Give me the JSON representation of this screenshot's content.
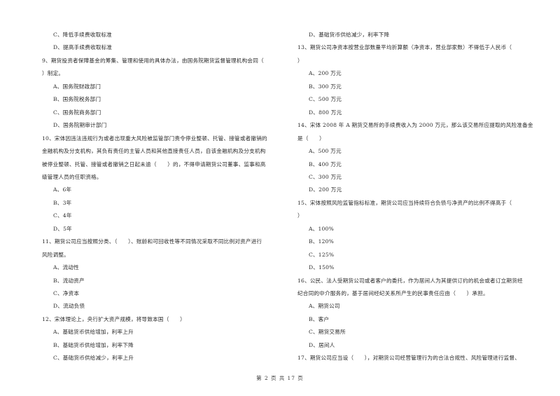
{
  "left_column": [
    {
      "kind": "option",
      "text": "C、降低手续费收取标准"
    },
    {
      "kind": "option",
      "text": "D、提高手续费收取标准"
    },
    {
      "kind": "question",
      "text": "9、期货投资者保障基金的筹集、管理和使用的具体办法，由国务院期货监督管理机构会同（"
    },
    {
      "kind": "cont",
      "text": "）制定。"
    },
    {
      "kind": "option",
      "text": "A、国务院财政部门"
    },
    {
      "kind": "option",
      "text": "B、国务院税务部门"
    },
    {
      "kind": "option",
      "text": "C、国务院商务部门"
    },
    {
      "kind": "option",
      "text": "D、国务院期审计部门"
    },
    {
      "kind": "question",
      "text": "10、宋体因违法违规行为或者出现重大风险被监管部门责令停业整顿、托管、接管或者撤销的"
    },
    {
      "kind": "cont",
      "text": "金融机构及分支机构，其负有责任的主管人员和其他直接责任人员，自该金融机构及分支机构"
    },
    {
      "kind": "cont",
      "text": "被停业整顿、托管、接管或者撤销之日起未逾（　　）的，不得申请期货公司董事、监事和高"
    },
    {
      "kind": "cont",
      "text": "级管理人员的任职资格。"
    },
    {
      "kind": "option",
      "text": "A、6年"
    },
    {
      "kind": "option",
      "text": "B、3年"
    },
    {
      "kind": "option",
      "text": "C、4年"
    },
    {
      "kind": "option",
      "text": "D、5年"
    },
    {
      "kind": "question",
      "text": "11、期货公司应当按照分类、（　　）、账龄和可回收性等不同情况采取不同比例对资产进行"
    },
    {
      "kind": "cont",
      "text": "风险调整。"
    },
    {
      "kind": "option",
      "text": "A、流动性"
    },
    {
      "kind": "option",
      "text": "B、流动资产"
    },
    {
      "kind": "option",
      "text": "C、净资本"
    },
    {
      "kind": "option",
      "text": "D、流动负债"
    },
    {
      "kind": "question",
      "text": "12、宋体理论上，央行扩大资产规模，将导致本国（　　）"
    },
    {
      "kind": "option",
      "text": "A、基础货币供给增加，利率上升"
    },
    {
      "kind": "option",
      "text": "B、基础货币供给增加，利率下降"
    },
    {
      "kind": "option",
      "text": "C、基础货币供给减少，利率上升"
    }
  ],
  "right_column": [
    {
      "kind": "option",
      "text": "D、基础货币供给减少，利率下降"
    },
    {
      "kind": "question",
      "text": "13、期货公司净资本按营业部数量平均折算额（净资本，营业部家数）不得低于人民币（"
    },
    {
      "kind": "cont",
      "text": "）"
    },
    {
      "kind": "option",
      "text": "A、200 万元"
    },
    {
      "kind": "option",
      "text": "B、300 万元"
    },
    {
      "kind": "option",
      "text": "C、500 万元"
    },
    {
      "kind": "option",
      "text": "D、800 万元"
    },
    {
      "kind": "question",
      "text": "14、宋体 2008 年 A 期货交易所的手续费收入为 2000 万元，那么该交易所应提取的风险准备金"
    },
    {
      "kind": "cont",
      "text": "是（　　）"
    },
    {
      "kind": "option",
      "text": "A、500 万元"
    },
    {
      "kind": "option",
      "text": "B、400 万元"
    },
    {
      "kind": "option",
      "text": "C、300 万元"
    },
    {
      "kind": "option",
      "text": "D、200 万元"
    },
    {
      "kind": "question",
      "text": "15、宋体按照风险监管指标标准，期货公司应当持续符合负债与净资产的比例不得高于（"
    },
    {
      "kind": "cont",
      "text": "）"
    },
    {
      "kind": "option",
      "text": "A、100%"
    },
    {
      "kind": "option",
      "text": "B、120%"
    },
    {
      "kind": "option",
      "text": "C、125%"
    },
    {
      "kind": "option",
      "text": "D、150%"
    },
    {
      "kind": "question",
      "text": "16、公民、法人受期货公司或者客户的委托，作为居间人为其提供订约的机会或者订立期货经"
    },
    {
      "kind": "cont",
      "text": "纪合同的中介服务的，基于居间经纪关系所产生的民事责任应由（　　）承担。"
    },
    {
      "kind": "option",
      "text": "A、期货公司"
    },
    {
      "kind": "option",
      "text": "B、客户"
    },
    {
      "kind": "option",
      "text": "C、期货交易所"
    },
    {
      "kind": "option",
      "text": "D、居间人"
    },
    {
      "kind": "question",
      "text": "17、期货公司应当设（　　），对期货公司经营管理行为的合法合规性、风险管理进行监督、"
    }
  ],
  "footer": {
    "page_label": "第 2 页 共 17 页"
  }
}
